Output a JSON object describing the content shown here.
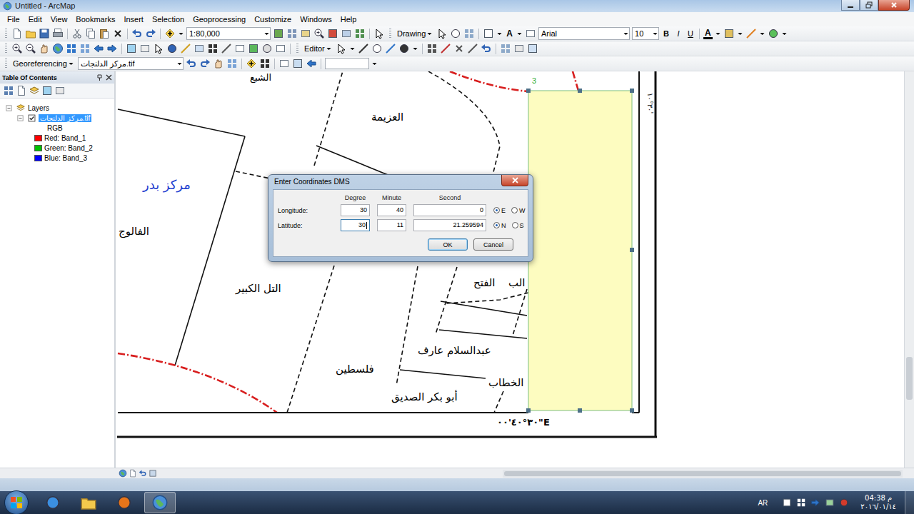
{
  "window": {
    "title": "Untitled - ArcMap"
  },
  "menu": [
    "File",
    "Edit",
    "View",
    "Bookmarks",
    "Insert",
    "Selection",
    "Geoprocessing",
    "Customize",
    "Windows",
    "Help"
  ],
  "standard_toolbar": {
    "scale": "1:80,000"
  },
  "drawing_toolbar": {
    "label": "Drawing",
    "text_tool": "A",
    "font": "Arial",
    "font_size": "10",
    "styles": [
      {
        "label": "B",
        "selected": false
      },
      {
        "label": "I",
        "selected": false
      },
      {
        "label": "U",
        "selected": false
      }
    ],
    "font_color": "A"
  },
  "editor_toolbar": {
    "label": "Editor"
  },
  "georeferencing_toolbar": {
    "label": "Georeferencing",
    "layer": "مركز الدلنجات.tif",
    "field": ""
  },
  "toc": {
    "title": "Table Of Contents",
    "root": {
      "label": "Layers",
      "expanded": true
    },
    "layer": {
      "name": "مركز الدلنجات.tif",
      "checked": true,
      "expanded": true,
      "selected": true
    },
    "renderer": "RGB",
    "bands": [
      {
        "channel": "Red:",
        "band": "Band_1",
        "color": "#ff0000"
      },
      {
        "channel": "Green:",
        "band": "Band_2",
        "color": "#00c000"
      },
      {
        "channel": "Blue:",
        "band": "Band_3",
        "color": "#0000ff"
      }
    ]
  },
  "map": {
    "labels": [
      {
        "text": "الشبع",
        "color": "#000000"
      },
      {
        "text": "العزيمة",
        "color": "#000000"
      },
      {
        "text": "مركز بدر",
        "color": "#1f3fd0"
      },
      {
        "text": "الفالوج",
        "color": "#000000"
      },
      {
        "text": "التل الكبير",
        "color": "#000000"
      },
      {
        "text": "الفتح",
        "color": "#000000"
      },
      {
        "text": "الب",
        "color": "#000000"
      },
      {
        "text": "عبدالسلام عارف",
        "color": "#000000"
      },
      {
        "text": "فلسطين",
        "color": "#000000"
      },
      {
        "text": "الخطاب",
        "color": "#000000"
      },
      {
        "text": "أبو بكر الصديق",
        "color": "#000000"
      }
    ],
    "control_point": "3",
    "bottom_coordinate": "٣٠°٤٠'٠٠\"E",
    "side_coordinate": "٣٠°١٠'"
  },
  "dialog": {
    "title": "Enter Coordinates DMS",
    "headers": [
      "Degree",
      "Minute",
      "Second"
    ],
    "rows": [
      {
        "label": "Longitude:",
        "degree": "30",
        "minute": "40",
        "second": "0",
        "focused": false,
        "options": [
          {
            "label": "E",
            "selected": true
          },
          {
            "label": "W",
            "selected": false
          }
        ]
      },
      {
        "label": "Latitude:",
        "degree": "30",
        "minute": "11",
        "second": "21.259594",
        "focused": true,
        "options": [
          {
            "label": "N",
            "selected": true
          },
          {
            "label": "S",
            "selected": false
          }
        ]
      }
    ],
    "buttons": [
      {
        "label": "OK",
        "default": true
      },
      {
        "label": "Cancel",
        "default": false
      }
    ]
  },
  "taskbar": {
    "language": "AR",
    "time": "04:38 م",
    "date": "٢٠١٦/٠١/١٤"
  }
}
